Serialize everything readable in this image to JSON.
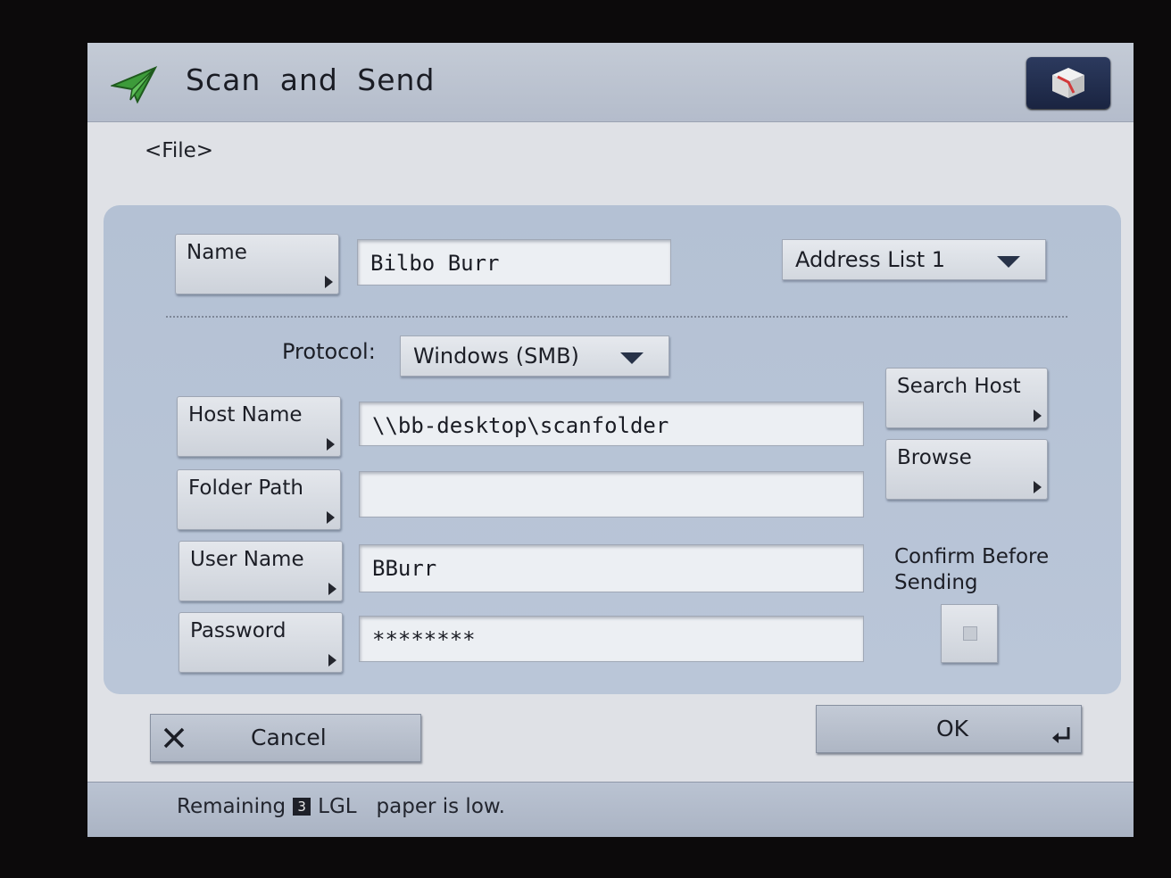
{
  "header": {
    "title": "Scan and Send",
    "subtitle": "<File>"
  },
  "name_row": {
    "name_button": "Name",
    "name_value": "Bilbo Burr",
    "address_list": "Address List 1"
  },
  "protocol": {
    "label": "Protocol:",
    "selected": "Windows (SMB)"
  },
  "fields": {
    "host_name": {
      "label": "Host Name",
      "value": "\\\\bb-desktop\\scanfolder"
    },
    "folder_path": {
      "label": "Folder Path",
      "value": ""
    },
    "user_name": {
      "label": "User Name",
      "value": "BBurr"
    },
    "password": {
      "label": "Password",
      "value": "********"
    }
  },
  "side": {
    "search_host": "Search Host",
    "browse": "Browse",
    "confirm_label_line1": "Confirm Before",
    "confirm_label_line2": "Sending",
    "confirm_checked": false
  },
  "actions": {
    "cancel": "Cancel",
    "ok": "OK"
  },
  "status": {
    "prefix": "Remaining",
    "count": "3",
    "paper": "LGL",
    "message": "paper is low."
  },
  "icons": [
    "send-arrow-icon",
    "cube-icon",
    "close-icon",
    "enter-icon"
  ],
  "colors": {
    "panel": "#b4c1d4",
    "title_bar": "#c4cbd6",
    "corner_button": "#1a2441"
  }
}
